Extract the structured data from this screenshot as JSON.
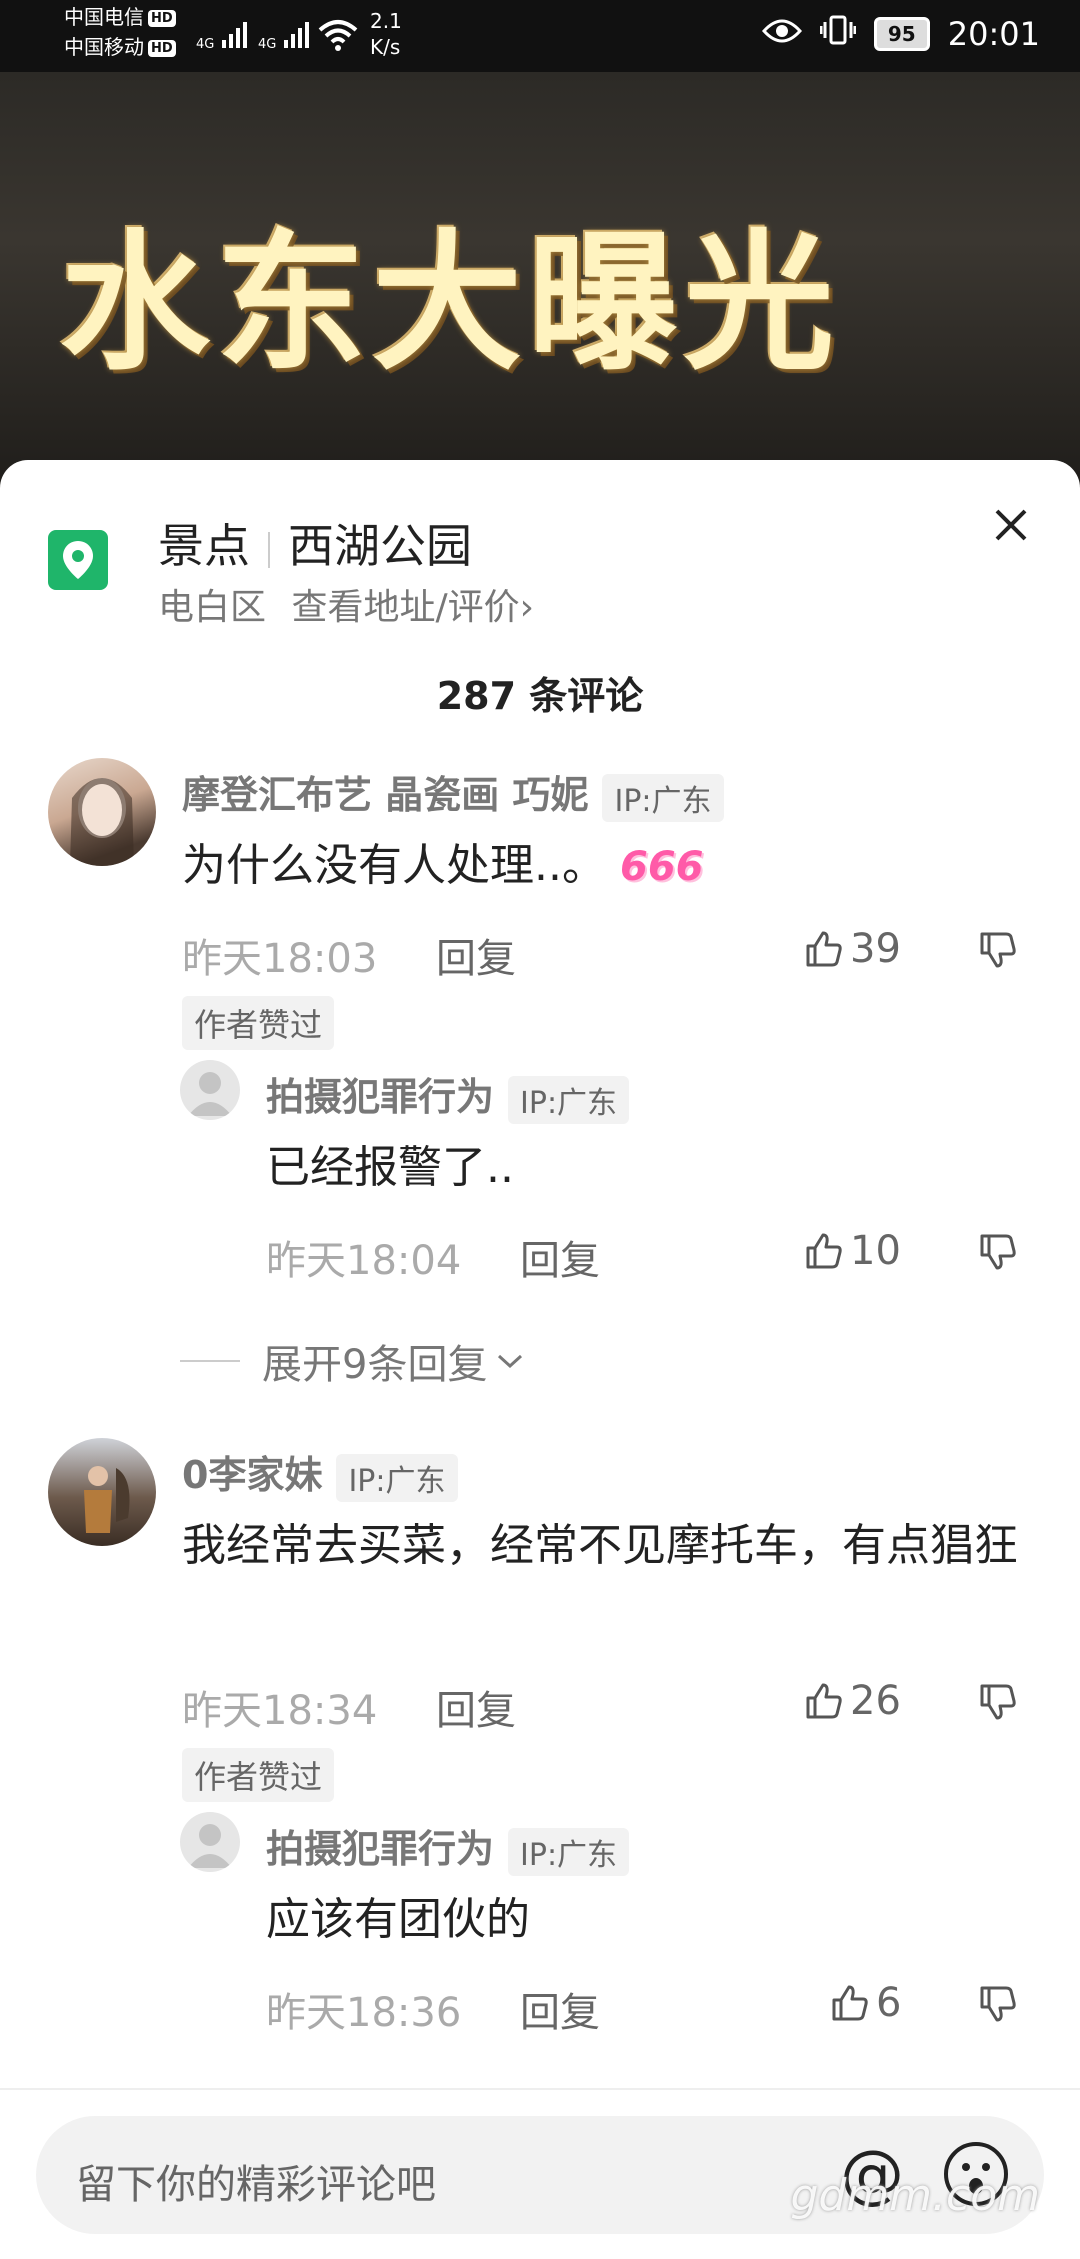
{
  "status_bar": {
    "carrier1": "中国电信",
    "carrier2": "中国移动",
    "hd": "HD",
    "net1": "4G",
    "net2": "4G",
    "speed_value": "2.1",
    "speed_unit": "K/s",
    "battery": "95",
    "time": "20:01"
  },
  "video": {
    "title": "水东大曝光"
  },
  "location": {
    "category": "景点",
    "name": "西湖公园",
    "district": "电白区",
    "link": "查看地址/评价",
    "link_chevron": "›",
    "icon": "location-pin-icon",
    "accent": "#1fb56a"
  },
  "comments_header": {
    "count": "287 条评论"
  },
  "comments": [
    {
      "user": "摩登汇布艺 晶瓷画 巧妮",
      "ip": "IP:广东",
      "text": "为什么没有人处理..。",
      "emoji": "666",
      "time": "昨天18:03",
      "reply": "回复",
      "likes": "39",
      "badge": "作者赞过",
      "replies": [
        {
          "user": "拍摄犯罪行为",
          "ip": "IP:广东",
          "text": "已经报警了..",
          "time": "昨天18:04",
          "reply": "回复",
          "likes": "10"
        }
      ],
      "expand": "展开9条回复"
    },
    {
      "user": "0李家妹",
      "ip": "IP:广东",
      "text": "我经常去买菜，经常不见摩托车，有点猖狂",
      "time": "昨天18:34",
      "reply": "回复",
      "likes": "26",
      "badge": "作者赞过",
      "replies": [
        {
          "user": "拍摄犯罪行为",
          "ip": "IP:广东",
          "text": "应该有团伙的",
          "time": "昨天18:36",
          "reply": "回复",
          "likes": "6"
        }
      ]
    }
  ],
  "input": {
    "placeholder": "留下你的精彩评论吧",
    "at": "@"
  },
  "watermark": "gdmm.com"
}
